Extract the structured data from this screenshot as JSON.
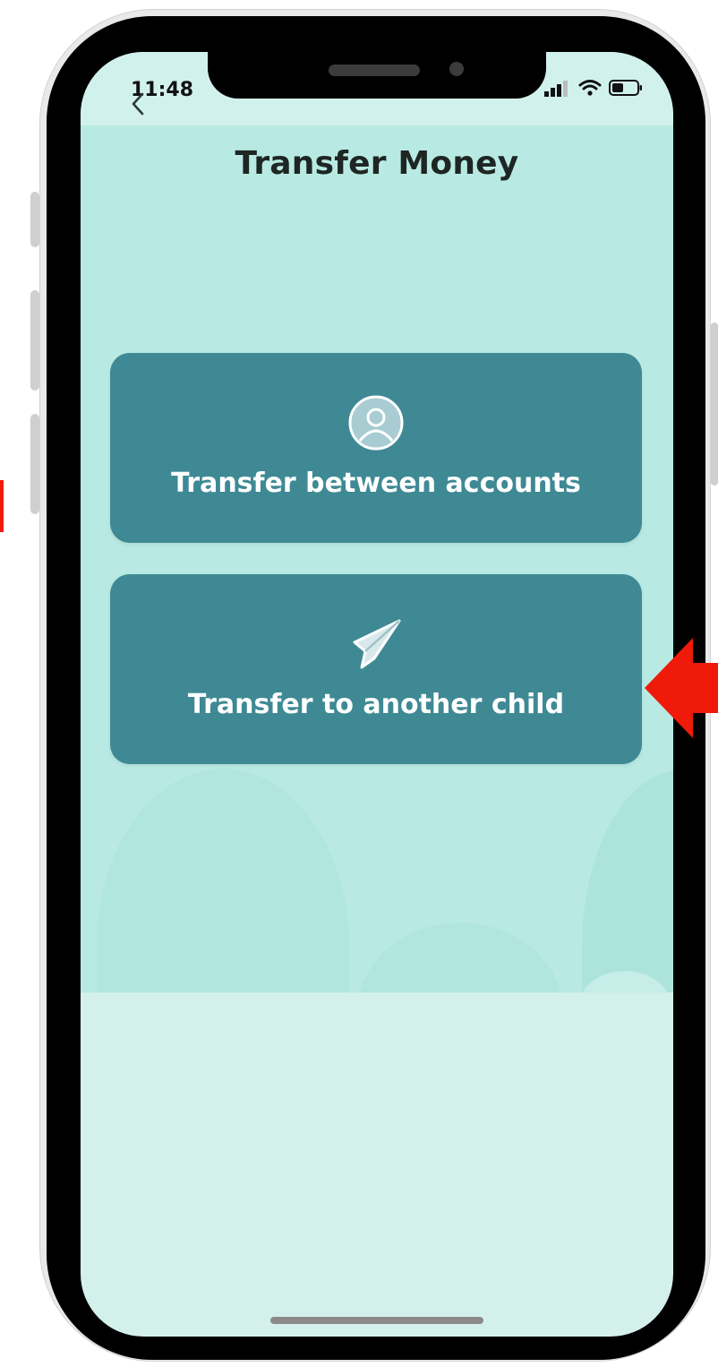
{
  "status_bar": {
    "time": "11:48"
  },
  "header": {
    "title": "Transfer Money",
    "back_icon": "chevron-left-icon"
  },
  "options": [
    {
      "label": "Transfer between accounts",
      "icon": "user-circle-icon"
    },
    {
      "label": "Transfer to another child",
      "icon": "paper-plane-icon"
    }
  ],
  "colors": {
    "card": "#3e8994",
    "hero_background": "#b8eae3",
    "lower_background": "#d4f0eb",
    "title_text": "#1e2623",
    "annotation_arrow": "#f01a0a"
  }
}
